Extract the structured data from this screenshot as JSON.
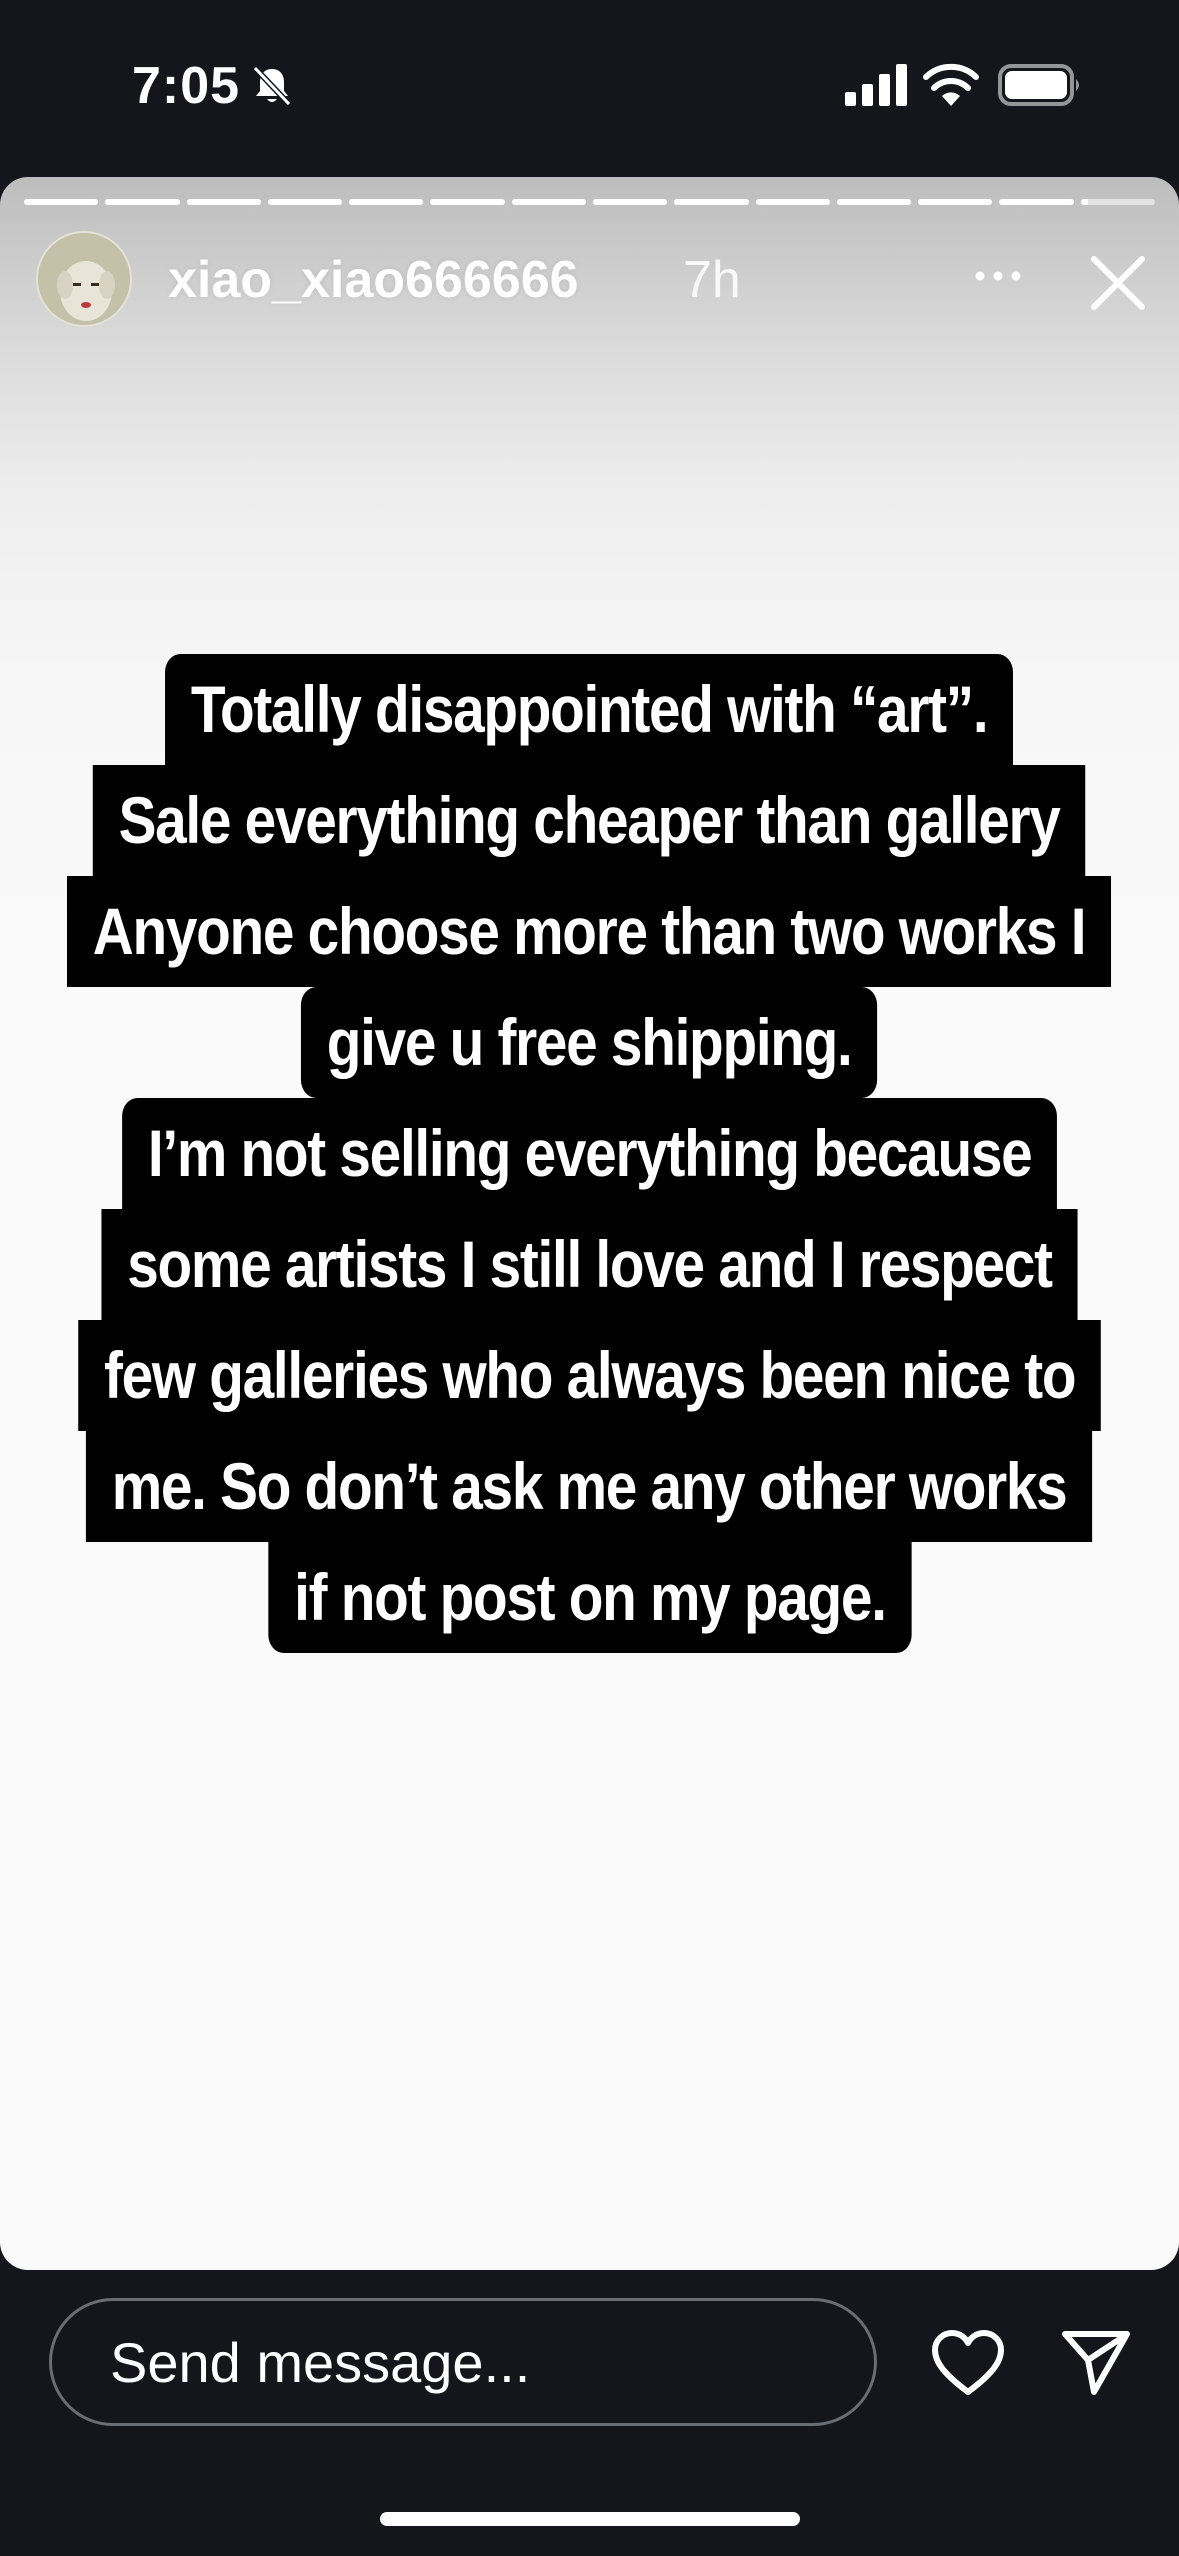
{
  "status_bar": {
    "time": "7:05",
    "icons": [
      "bell-muted-icon",
      "signal-icon",
      "wifi-icon",
      "battery-icon"
    ]
  },
  "story": {
    "segments_total": 14,
    "current_segment": 14,
    "current_segment_progress": 0.1,
    "username": "xiao_xiao666666",
    "timestamp": "7h",
    "text_lines": [
      "Totally disappointed with “art”.",
      "Sale everything cheaper than gallery",
      "Anyone choose more than two works I",
      "give u free shipping.",
      "I’m not selling everything because",
      "some artists I still love and I respect",
      "few galleries who always been nice to",
      "me. So don’t ask me any other works",
      "if not post on my page."
    ],
    "icons": [
      "more-icon",
      "close-icon"
    ]
  },
  "bottom_bar": {
    "message_placeholder": "Send message...",
    "icons": [
      "heart-icon",
      "send-icon"
    ]
  },
  "colors": {
    "background": "#14161c",
    "text_block": "#000000",
    "text": "#ffffff"
  }
}
